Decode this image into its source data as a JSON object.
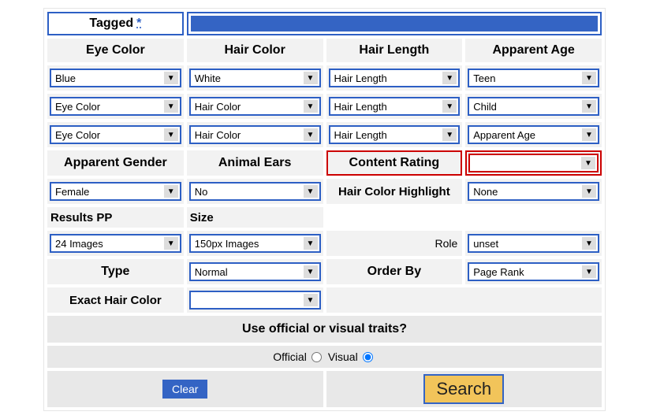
{
  "tagged": {
    "label": "Tagged",
    "star": "*"
  },
  "headers": {
    "eye_color": "Eye Color",
    "hair_color": "Hair Color",
    "hair_length": "Hair Length",
    "apparent_age": "Apparent Age",
    "apparent_gender": "Apparent Gender",
    "animal_ears": "Animal Ears",
    "content_rating": "Content Rating",
    "hair_highlight": "Hair Color Highlight",
    "results_pp": "Results PP",
    "size": "Size",
    "role": "Role",
    "type": "Type",
    "order_by": "Order By",
    "exact_hair": "Exact Hair Color"
  },
  "selects": {
    "eye1": "Blue",
    "eye2": "Eye Color",
    "eye3": "Eye Color",
    "hair1": "White",
    "hair2": "Hair Color",
    "hair3": "Hair Color",
    "len1": "Hair Length",
    "len2": "Hair Length",
    "len3": "Hair Length",
    "age1": "Teen",
    "age2": "Child",
    "age3": "Apparent Age",
    "content_rating": "",
    "gender": "Female",
    "ears": "No",
    "highlight": "None",
    "results": "24 Images",
    "size": "150px Images",
    "role": "unset",
    "type_val": "Normal",
    "order": "Page Rank",
    "exact": ""
  },
  "traits": {
    "question": "Use official or visual traits?",
    "official": "Official",
    "visual": "Visual"
  },
  "buttons": {
    "clear": "Clear",
    "search": "Search"
  }
}
